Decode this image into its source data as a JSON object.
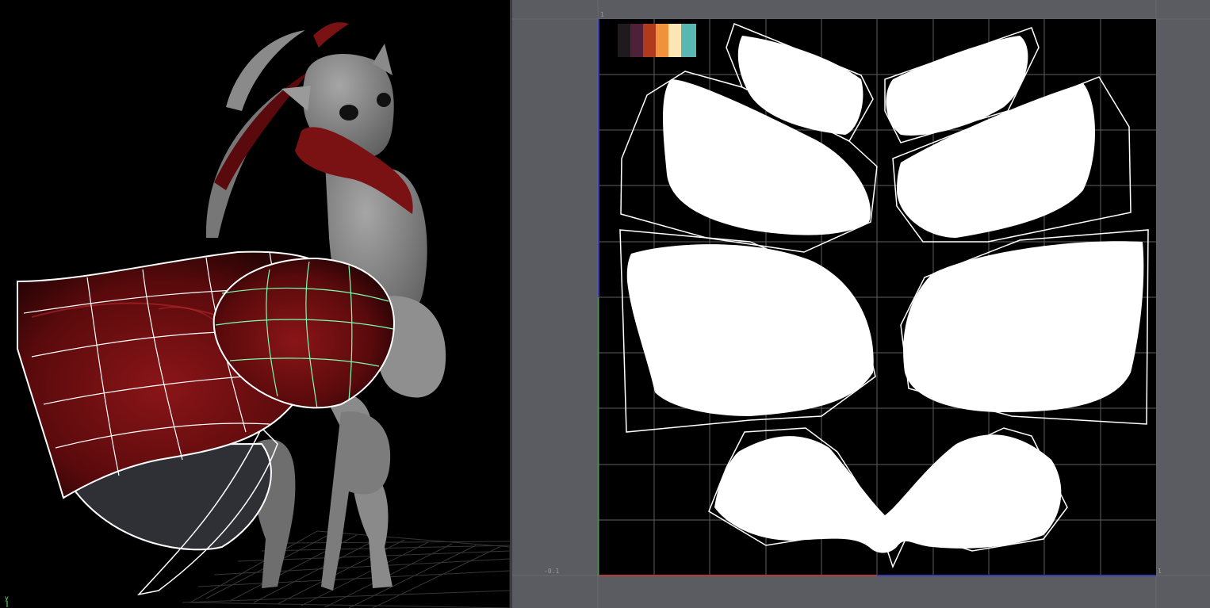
{
  "viewport": {
    "axis_indicator": "y",
    "colors": {
      "wing_red": "#7a1214",
      "wing_dark": "#3a0708",
      "body_gray": "#8c8c8c",
      "wireframe": "#ffffff",
      "selection_green": "#7cffb0"
    }
  },
  "uv_editor": {
    "labels": {
      "top_left": "1",
      "bottom_left": "-0.1",
      "bottom_right": "1"
    },
    "palette": [
      {
        "name": "swatch-black",
        "color": "#1e1a1e"
      },
      {
        "name": "swatch-plum",
        "color": "#4e2139"
      },
      {
        "name": "swatch-rust",
        "color": "#b23a1c"
      },
      {
        "name": "swatch-orange",
        "color": "#f0913c"
      },
      {
        "name": "swatch-cream",
        "color": "#fde6b4"
      },
      {
        "name": "swatch-teal",
        "color": "#58b7b1"
      }
    ],
    "colors": {
      "background": "#5b5b62",
      "uv_tile": "#000000",
      "grid": "#5f5f5f",
      "island_fill": "#ffffff",
      "u_axis": "#b23a3a",
      "v_axis": "#3a3ab2"
    }
  }
}
